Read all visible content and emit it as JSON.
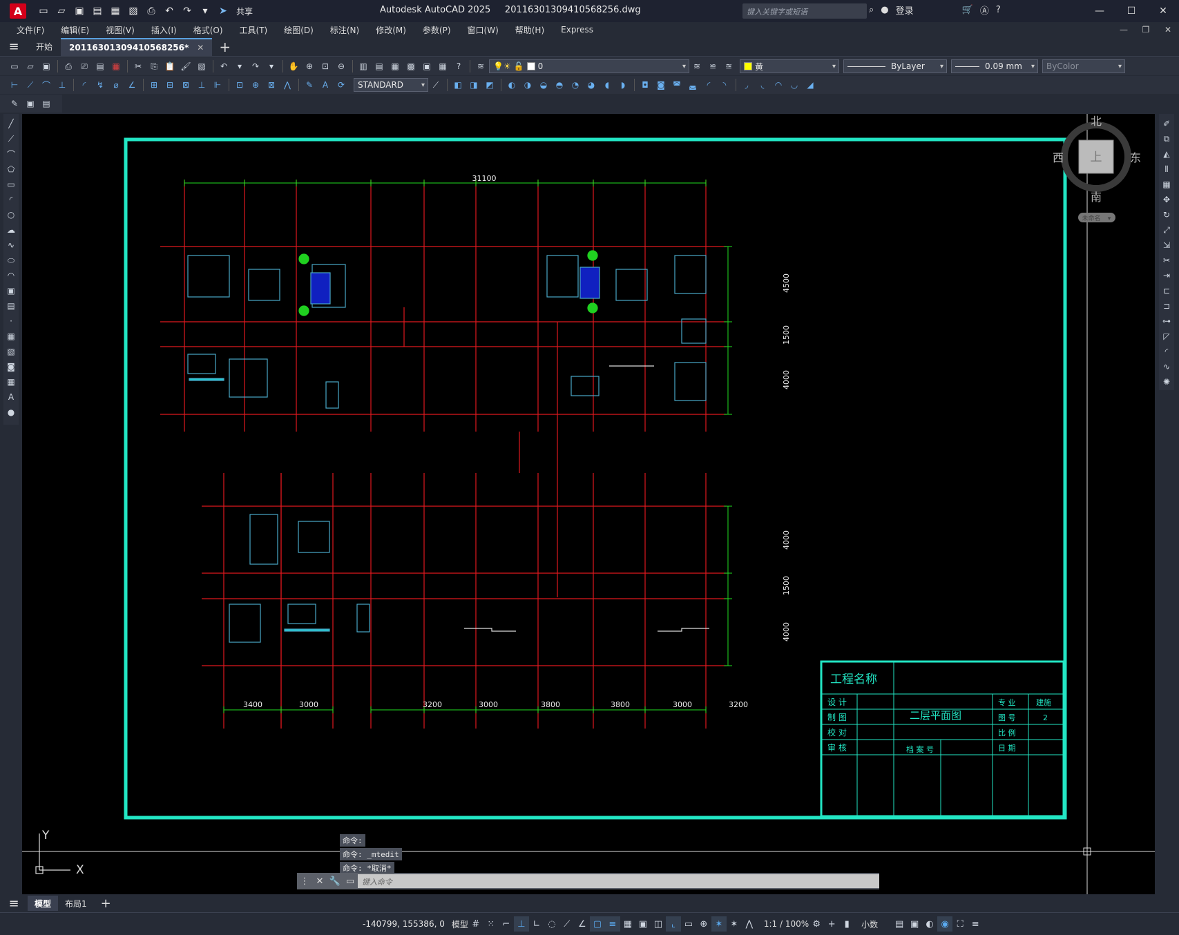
{
  "app": {
    "title": "Autodesk AutoCAD 2025",
    "filename": "20116301309410568256.dwg",
    "share": "共享",
    "search_placeholder": "键入关键字或短语",
    "login": "登录"
  },
  "menu": [
    "文件(F)",
    "编辑(E)",
    "视图(V)",
    "插入(I)",
    "格式(O)",
    "工具(T)",
    "绘图(D)",
    "标注(N)",
    "修改(M)",
    "参数(P)",
    "窗口(W)",
    "帮助(H)",
    "Express"
  ],
  "tabs": {
    "start": "开始",
    "doc": "20116301309410568256*"
  },
  "toolbar": {
    "layer": "0",
    "color": "黄",
    "color_hex": "#ffff00",
    "linetype": "ByLayer",
    "lineweight": "0.09 mm",
    "plotstyle": "ByColor",
    "textstyle": "STANDARD"
  },
  "compass": {
    "north": "北",
    "south": "南",
    "east": "东",
    "west": "西",
    "top": "上",
    "wcs": "未命名"
  },
  "drawing": {
    "total_dim": "31100",
    "bottom_dims": [
      "3400",
      "3000",
      "3200",
      "3000",
      "3800",
      "3800",
      "3000",
      "3200"
    ],
    "right_dims_top": [
      "4500",
      "1500",
      "4000"
    ],
    "right_dims_bottom": [
      "4000",
      "1500",
      "4000"
    ],
    "titleblock": {
      "project": "工程名称",
      "design": "设  计",
      "draw": "制  图",
      "check": "校  对",
      "review": "审  核",
      "archive": "档 案 号",
      "drawing_name": "二层平面图",
      "major_label": "专  业",
      "major_value": "建施",
      "sheet_label": "图  号",
      "sheet_value": "2",
      "scale_label": "比  例",
      "date_label": "日  期"
    },
    "ucs_x": "X",
    "ucs_y": "Y"
  },
  "command": {
    "history": [
      "命令:",
      "命令: _mtedit",
      "命令: *取消*"
    ],
    "placeholder": "键入命令"
  },
  "layouts": {
    "model": "模型",
    "layout1": "布局1"
  },
  "status": {
    "coords": "-140799, 155386, 0",
    "model": "模型",
    "scale": "1:1 / 100%",
    "units": "小数"
  }
}
